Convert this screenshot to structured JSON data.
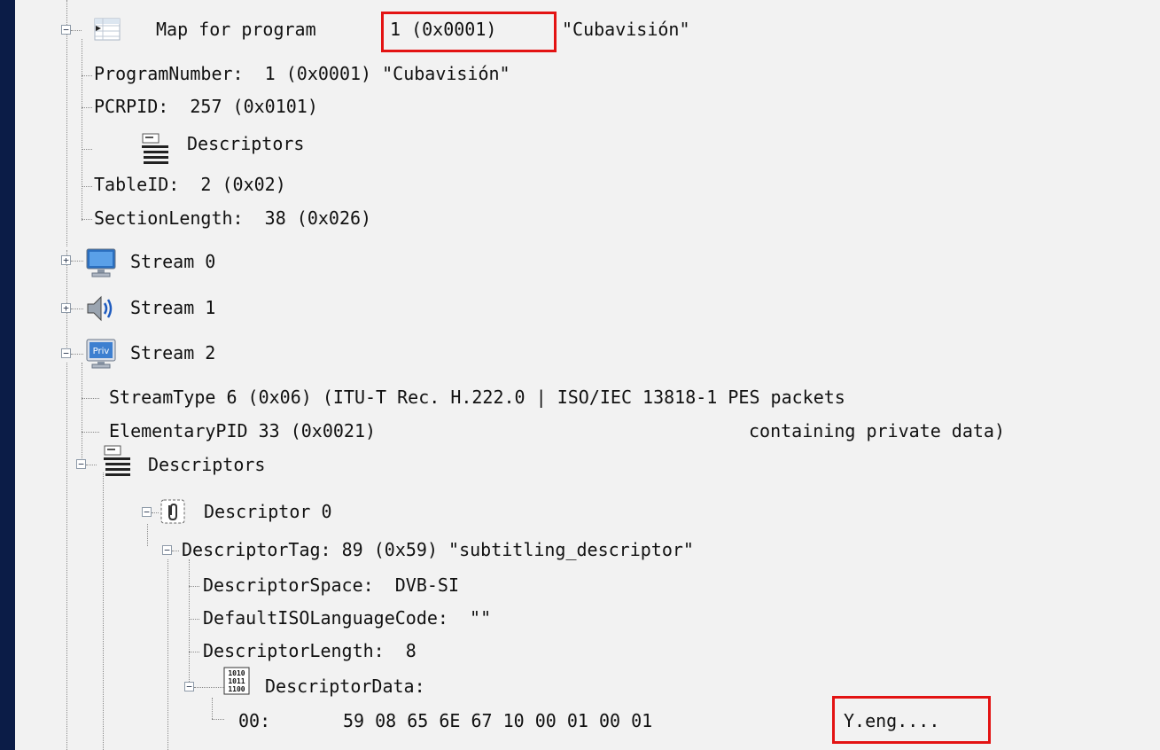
{
  "tree": {
    "map_label": "Map for program",
    "map_program_value": "1 (0x0001)",
    "map_program_name": "\"Cubavisión\"",
    "program_number": "ProgramNumber:  1 (0x0001) \"Cubavisión\"",
    "pcr_pid": "PCRPID:  257 (0x0101)",
    "descriptors_1": "Descriptors",
    "table_id": "TableID:  2 (0x02)",
    "section_length": "SectionLength:  38 (0x026)",
    "stream0": "Stream 0",
    "stream1": "Stream 1",
    "stream2": "Stream 2",
    "stream_type": "StreamType 6 (0x06) (ITU-T Rec. H.222.0 | ISO/IEC 13818-1 PES packets",
    "elementary_pid": "ElementaryPID 33 (0x0021)",
    "stream_type_cont": "containing private data)",
    "descriptors_2": "Descriptors",
    "descriptor0": "Descriptor 0",
    "descriptor_tag": "DescriptorTag: 89 (0x59) \"subtitling_descriptor\"",
    "descriptor_space": "DescriptorSpace:  DVB-SI",
    "default_iso_lang": "DefaultISOLanguageCode:  \"\"",
    "descriptor_length": "DescriptorLength:  8",
    "descriptor_data": "DescriptorData:",
    "hex_offset": "00:",
    "hex_bytes": "59 08 65 6E 67 10 00 01 00 01",
    "hex_ascii": "Y.eng....",
    "priv_icon_text": "Priv",
    "binary_icon_text": [
      "1010",
      "1011",
      "1100"
    ]
  },
  "colors": {
    "highlight": "#e31313",
    "background": "#0b1c47",
    "panel": "#f2f2f2"
  },
  "icons": [
    "table-icon",
    "descriptors-list-icon",
    "monitor-icon",
    "speaker-icon",
    "priv-icon",
    "descriptor-clip-icon",
    "binary-data-icon"
  ]
}
